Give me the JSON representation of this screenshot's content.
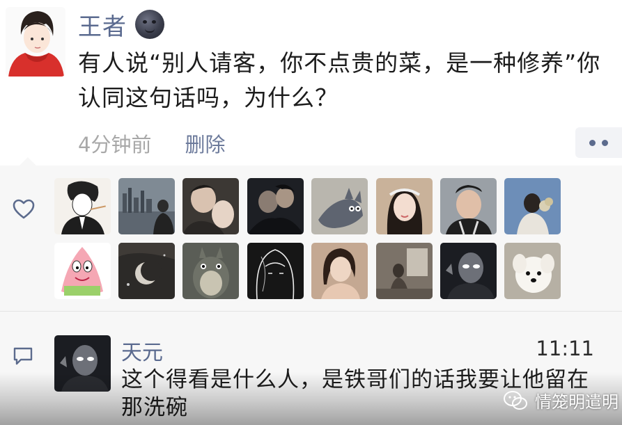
{
  "post": {
    "author": "王者",
    "author_emoji": "new-moon-face-emoji",
    "text": "有人说“别人请客，你不点贵的菜，是一种修养”你认同这句话吗，为什么？",
    "time": "4分钟前",
    "delete_label": "删除",
    "more_icon": "more-dots-icon"
  },
  "likes": {
    "icon": "heart-outline-icon",
    "avatars": [
      {
        "name": "like-avatar-1",
        "desc": "anime boy in suit with cigarette"
      },
      {
        "name": "like-avatar-2",
        "desc": "city skyline with person"
      },
      {
        "name": "like-avatar-3",
        "desc": "two people close-up"
      },
      {
        "name": "like-avatar-4",
        "desc": "couple in dark"
      },
      {
        "name": "like-avatar-5",
        "desc": "tom cat cartoon"
      },
      {
        "name": "like-avatar-6",
        "desc": "girl with headband"
      },
      {
        "name": "like-avatar-7",
        "desc": "boy selfie"
      },
      {
        "name": "like-avatar-8",
        "desc": "person with flowers"
      },
      {
        "name": "like-avatar-9",
        "desc": "patrick star"
      },
      {
        "name": "like-avatar-10",
        "desc": "dark crescent moon"
      },
      {
        "name": "like-avatar-11",
        "desc": "totoro"
      },
      {
        "name": "like-avatar-12",
        "desc": "anime line art"
      },
      {
        "name": "like-avatar-13",
        "desc": "woman portrait"
      },
      {
        "name": "like-avatar-14",
        "desc": "room with figure"
      },
      {
        "name": "like-avatar-15",
        "desc": "masked figure glowing eyes"
      },
      {
        "name": "like-avatar-16",
        "desc": "white puppy"
      }
    ]
  },
  "comment": {
    "icon": "comment-bubble-icon",
    "author": "天元",
    "time": "11:11",
    "text": "这个得看是什么人，是铁哥们的话我要让他留在那洗碗"
  },
  "watermark": {
    "text": "情笼明遣明",
    "icon": "wechat-icon"
  },
  "colors": {
    "name_blue": "#5a6a8f",
    "time_gray": "#a8a8a8",
    "panel_bg": "#f7f7f7"
  }
}
